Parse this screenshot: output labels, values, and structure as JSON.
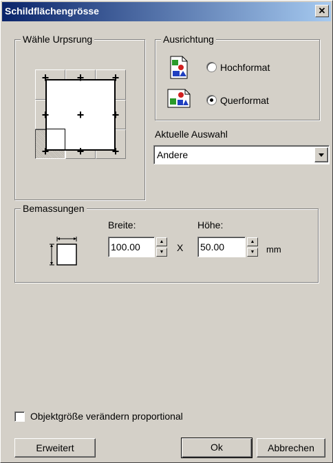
{
  "window": {
    "title": "Schildflächengrösse",
    "close_glyph": "✕"
  },
  "origin": {
    "label": "Wähle Urpsrung"
  },
  "orientation": {
    "label": "Ausrichtung",
    "options": [
      {
        "label": "Hochformat",
        "selected": false
      },
      {
        "label": "Querformat",
        "selected": true
      }
    ]
  },
  "selection": {
    "label": "Aktuelle Auswahl",
    "value": "Andere"
  },
  "dimensions": {
    "label": "Bemassungen",
    "width_label": "Breite:",
    "width_value": "100.00",
    "height_label": "Höhe:",
    "height_value": "50.00",
    "times": "X",
    "unit": "mm"
  },
  "proportional": {
    "label": "Objektgröße verändern proportional",
    "checked": false
  },
  "buttons": {
    "advanced": "Erweitert",
    "ok": "Ok",
    "cancel": "Abbrechen"
  }
}
